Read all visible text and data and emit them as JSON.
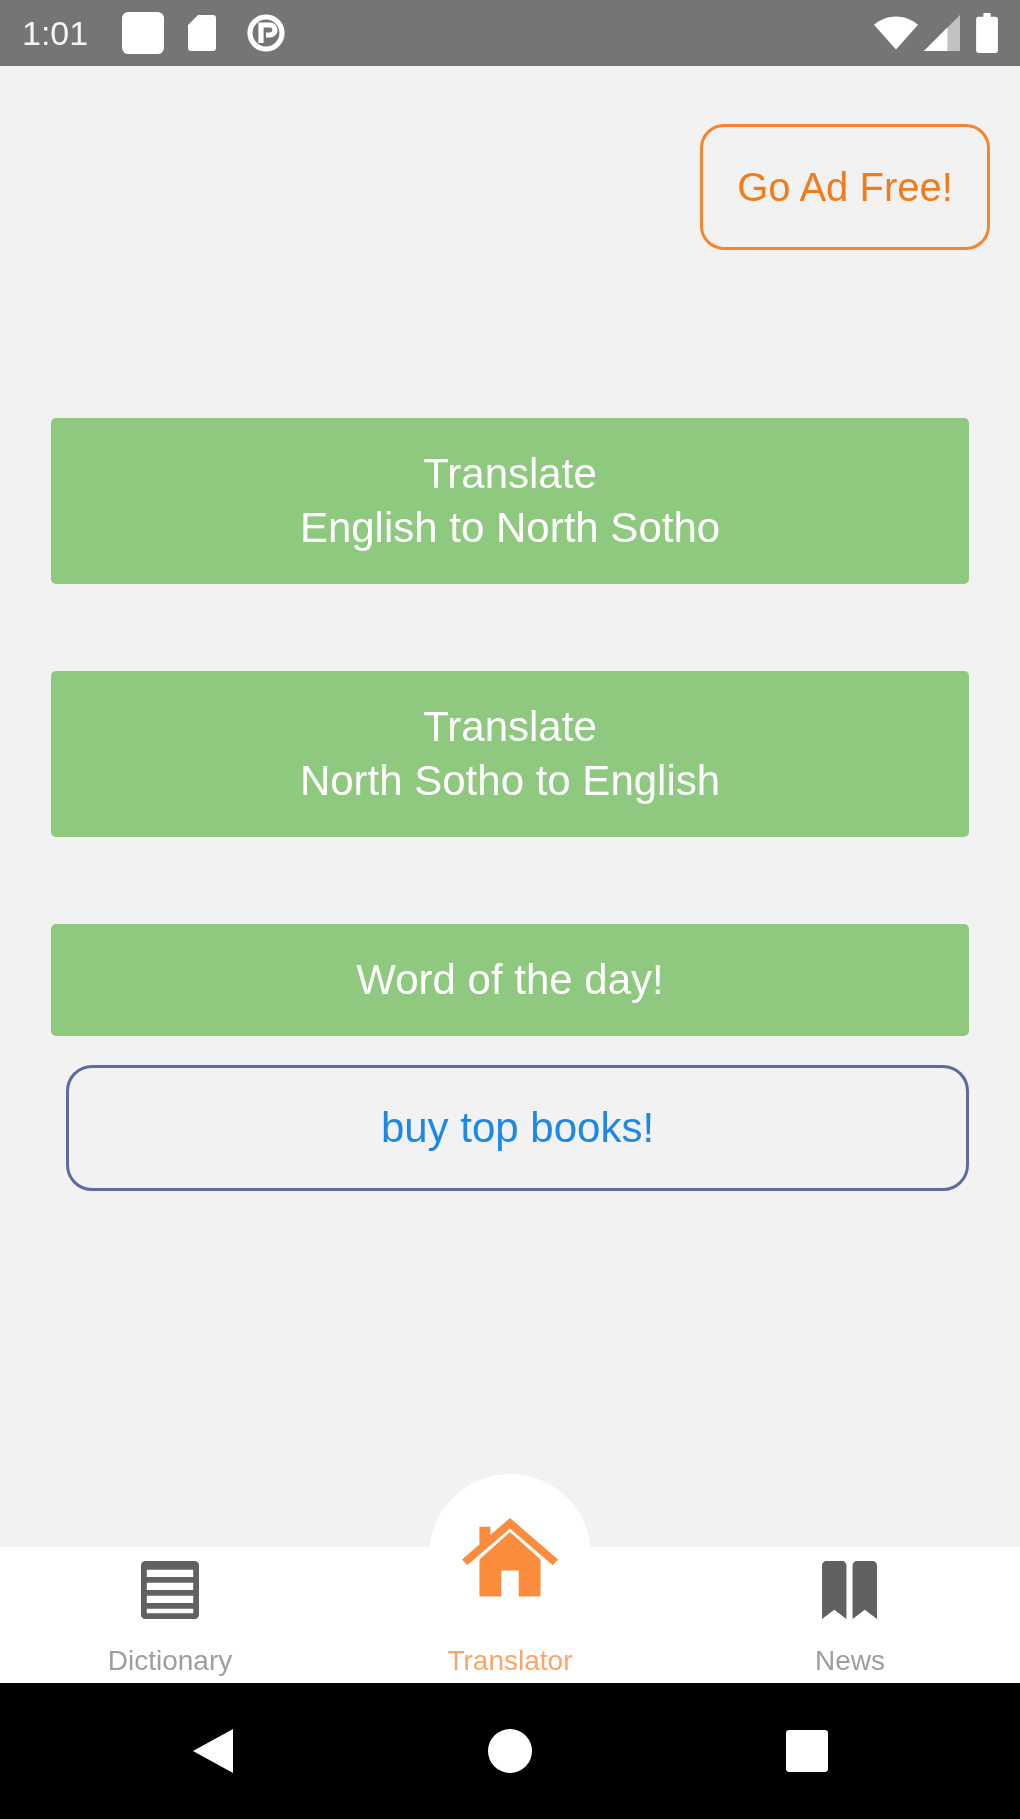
{
  "status_bar": {
    "time": "1:01"
  },
  "header": {
    "ad_free_button": {
      "label": "Go Ad Free!"
    }
  },
  "actions": [
    {
      "kind": "filled",
      "label": "Translate\nEnglish to North Sotho"
    },
    {
      "kind": "filled",
      "label": "Translate\nNorth Sotho to English"
    },
    {
      "kind": "filled",
      "label": "Word of the day!"
    },
    {
      "kind": "outlined",
      "label": "buy top books!"
    }
  ],
  "bottom_nav": {
    "items": [
      {
        "label": "Dictionary",
        "selected": false
      },
      {
        "label": "Translator",
        "selected": true
      },
      {
        "label": "News",
        "selected": false
      }
    ]
  }
}
